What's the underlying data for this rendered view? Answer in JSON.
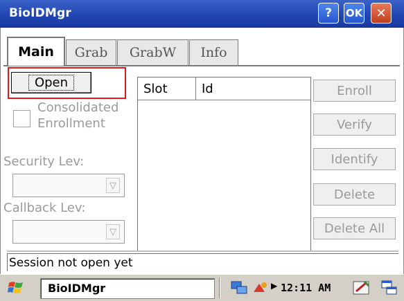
{
  "window": {
    "title": "BioIDMgr",
    "help_label": "?",
    "ok_label": "OK",
    "close_label": "✕"
  },
  "tabs": [
    {
      "label": "Main",
      "active": true
    },
    {
      "label": "Grab",
      "active": false
    },
    {
      "label": "GrabW",
      "active": false
    },
    {
      "label": "Info",
      "active": false
    }
  ],
  "main": {
    "open_button": "Open",
    "consolidated_label_line1": "Consolidated",
    "consolidated_label_line2": "Enrollment",
    "security_label": "Security Lev:",
    "callback_label": "Callback Lev:",
    "list_columns": [
      "Slot",
      "Id"
    ],
    "buttons": {
      "enroll": "Enroll",
      "verify": "Verify",
      "identify": "Identify",
      "delete": "Delete",
      "delete_all": "Delete All"
    },
    "status_text": "Session not open yet"
  },
  "taskbar": {
    "task_label": "BioIDMgr",
    "clock": "12:11 AM"
  },
  "colors": {
    "titlebar": "#1f44b0",
    "highlight": "#e0191c",
    "close_button": "#c23e1c"
  }
}
